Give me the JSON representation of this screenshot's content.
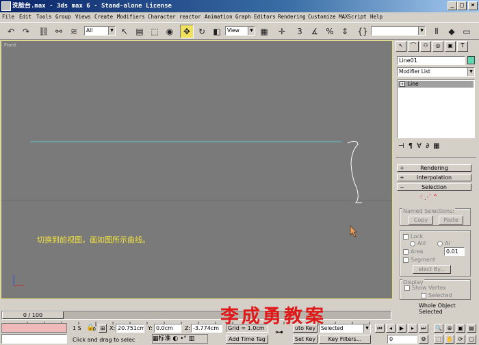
{
  "window": {
    "title": "洗脸台.max - 3ds max 6 - Stand-alone License"
  },
  "menu": [
    "File",
    "Edit",
    "Tools",
    "Group",
    "Views",
    "Create",
    "Modifiers",
    "Character",
    "reactor",
    "Animation",
    "Graph Editors",
    "Rendering",
    "Customize",
    "MAXScript",
    "Help"
  ],
  "toolbar": {
    "selection_filter": "All",
    "ref_coord": "View"
  },
  "viewport": {
    "label": "Front",
    "instruction": "切换到前视图，画如图所示曲线。",
    "line_color": "#5fc8c8",
    "border_color": "#e8e070"
  },
  "command_panel": {
    "object_name": "Line01",
    "object_color": "#5fd8b0",
    "modifier_list": "Modifier List",
    "stack_item": "Line",
    "rollouts": {
      "rendering": "Rendering",
      "interpolation": "Interpolation",
      "selection": "Selection"
    },
    "named_selections": {
      "title": "Named Selections:",
      "copy": "Copy",
      "paste": "Paste"
    },
    "lock": "Lock",
    "radio_all": "Alil",
    "radio_al": "Al",
    "area": "Area",
    "area_value": "0.01",
    "segment": "Segment",
    "select_by": "elect By...",
    "display": {
      "title": "Display",
      "show_vertex": "Show Vertex",
      "selected": "Selected"
    },
    "status": "Whole Object Selected"
  },
  "timeline": {
    "frame": "0 / 100",
    "ticks": [
      "0",
      "10",
      "20",
      "30",
      "40",
      "50",
      "60",
      "70",
      "80",
      "90",
      "100"
    ]
  },
  "status_bar": {
    "selected_count": "1 S",
    "x_label": "X:",
    "x_value": "20.751cm",
    "y_label": "Y:",
    "y_value": "0.0cm",
    "z_label": "Z:",
    "z_value": "-3.774cm",
    "grid": "Grid = 1.0cm",
    "prompt": "Click and drag to selec",
    "add_time_tag": "Add Time Tag",
    "auto_key": "uto Key",
    "set_key": "Set Key",
    "selected_dropdown": "Selected",
    "key_filters": "Key Filters...",
    "ime_label": "标准",
    "frame_value": "0"
  },
  "watermark": "李成勇教案"
}
